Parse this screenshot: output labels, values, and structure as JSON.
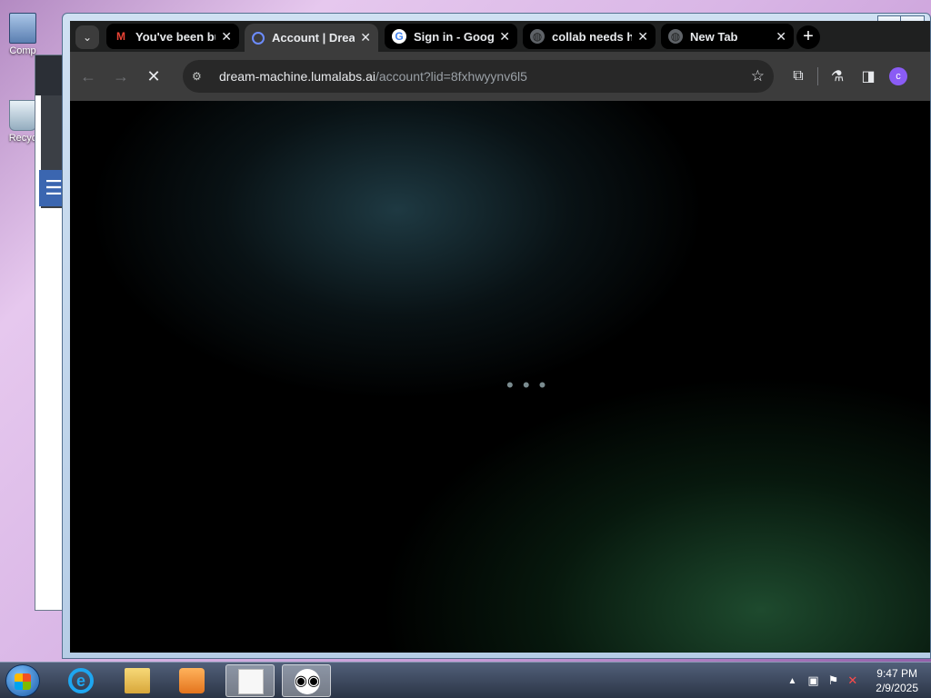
{
  "desktop": {
    "icons": [
      {
        "label": "Comp"
      },
      {
        "label": "Recyc"
      }
    ]
  },
  "window": {
    "controls": {
      "minimize": "–",
      "maximize": "▫"
    }
  },
  "browser": {
    "tab_search_glyph": "⌄",
    "tabs": [
      {
        "title": "You've been bu",
        "favicon": "gmail-icon",
        "fav_glyph": "M",
        "active": false
      },
      {
        "title": "Account | Drea",
        "favicon": "luma-icon",
        "fav_glyph": "",
        "active": true
      },
      {
        "title": "Sign in - Googl",
        "favicon": "google-icon",
        "fav_glyph": "G",
        "active": false
      },
      {
        "title": "collab needs h",
        "favicon": "globe-icon",
        "fav_glyph": "◍",
        "active": false
      },
      {
        "title": "New Tab",
        "favicon": "globe-icon",
        "fav_glyph": "◍",
        "active": false
      }
    ],
    "close_glyph": "✕",
    "new_tab_glyph": "+",
    "toolbar": {
      "back_glyph": "←",
      "forward_glyph": "→",
      "stop_glyph": "✕",
      "site_info_glyph": "⚙",
      "url_host": "dream-machine.lumalabs.ai",
      "url_path": "/account?lid=8fxhwyynv6l5",
      "star_glyph": "☆",
      "extensions_glyph": "⧉",
      "labs_glyph": "⚗",
      "sidepanel_glyph": "◨",
      "profile_initial": "c"
    },
    "page": {
      "loading_indicator": "• • •"
    }
  },
  "taskbar": {
    "items": [
      {
        "name": "internet-explorer",
        "glyph": "e",
        "active": false
      },
      {
        "name": "file-explorer",
        "glyph": "",
        "active": false
      },
      {
        "name": "media-player",
        "glyph": "",
        "active": false
      },
      {
        "name": "notepad",
        "glyph": "",
        "active": false
      },
      {
        "name": "chrome-incognito",
        "glyph": "◉◉",
        "active": true
      }
    ],
    "tray": {
      "show_hidden_glyph": "▲",
      "time": "9:47 PM",
      "date": "2/9/2025"
    }
  }
}
